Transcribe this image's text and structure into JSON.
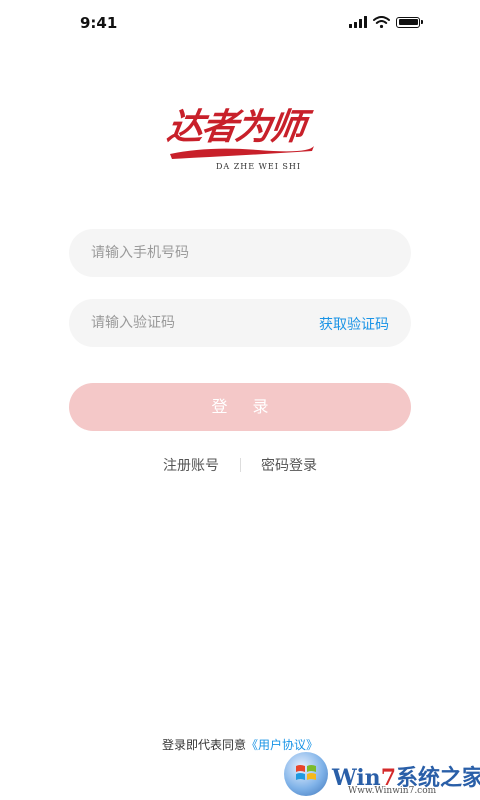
{
  "status_bar": {
    "time": "9:41"
  },
  "logo": {
    "title": "达者为师",
    "subtitle": "DA ZHE WEI SHI",
    "color": "#c8202a"
  },
  "form": {
    "phone_placeholder": "请输入手机号码",
    "code_placeholder": "请输入验证码",
    "get_code_label": "获取验证码",
    "login_label": "登 录"
  },
  "links": {
    "register": "注册账号",
    "password_login": "密码登录"
  },
  "agreement": {
    "prefix": "登录即代表同意",
    "link": "《用户协议》"
  },
  "watermark": {
    "brand_prefix": "Win",
    "brand_seven": "7",
    "brand_suffix": "系统之家",
    "url": "Www.Winwin7.com"
  },
  "colors": {
    "accent": "#1a94e6",
    "login_button": "#f4c8c8",
    "field_bg": "#f5f5f5"
  }
}
